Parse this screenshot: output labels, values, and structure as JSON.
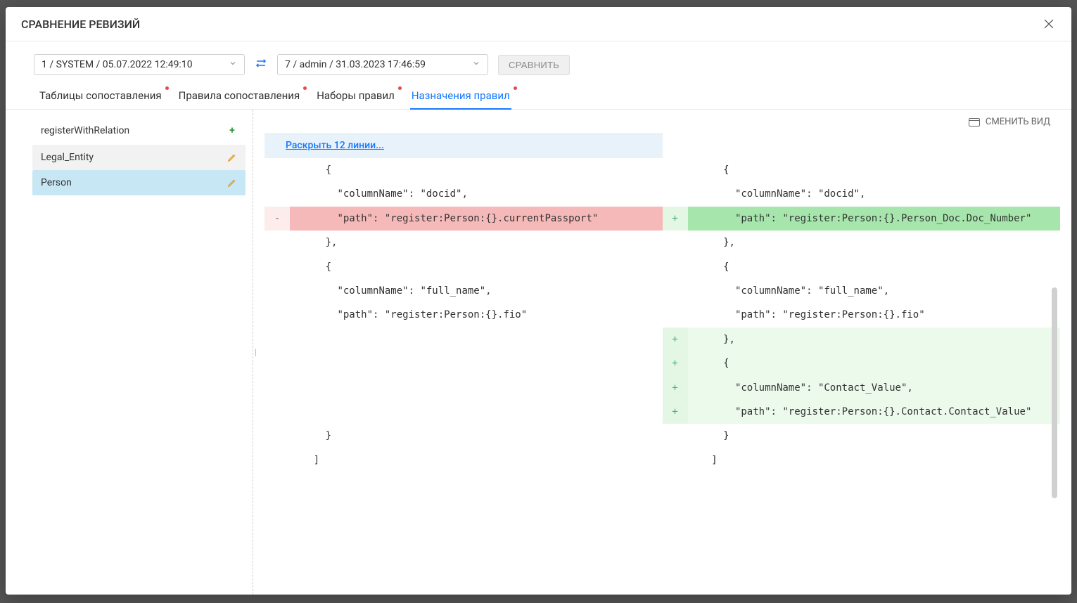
{
  "modal": {
    "title": "СРАВНЕНИЕ РЕВИЗИЙ"
  },
  "revisions": {
    "left": "1 / SYSTEM / 05.07.2022 12:49:10",
    "right": "7 / admin / 31.03.2023 17:46:59"
  },
  "buttons": {
    "compare": "СРАВНИТЬ",
    "change_view": "СМЕНИТЬ ВИД"
  },
  "tabs": {
    "t0": "Таблицы сопоставления",
    "t1": "Правила сопоставления",
    "t2": "Наборы правил",
    "t3": "Назначения правил"
  },
  "sidebar": {
    "parent": "registerWithRelation",
    "items": {
      "i0": "Legal_Entity",
      "i1": "Person"
    }
  },
  "diff": {
    "expand": "Раскрыть 12 линии...",
    "left": {
      "l0": "      {",
      "l1": "        \"columnName\": \"docid\",",
      "l2": "        \"path\": \"register:Person:{}.currentPassport\"",
      "l3": "      },",
      "l4": "      {",
      "l5": "        \"columnName\": \"full_name\",",
      "l6": "        \"path\": \"register:Person:{}.fio\"",
      "l7": "      }",
      "l8": "    ]"
    },
    "right": {
      "r0": "      {",
      "r1": "        \"columnName\": \"docid\",",
      "r2": "        \"path\": \"register:Person:{}.Person_Doc.Doc_Number\"",
      "r3": "      },",
      "r4": "      {",
      "r5": "        \"columnName\": \"full_name\",",
      "r6": "        \"path\": \"register:Person:{}.fio\"",
      "r7": "      },",
      "r8": "      {",
      "r9": "        \"columnName\": \"Contact_Value\",",
      "r10": "        \"path\": \"register:Person:{}.Contact.Contact_Value\"",
      "r11": "      }",
      "r12": "    ]"
    }
  }
}
